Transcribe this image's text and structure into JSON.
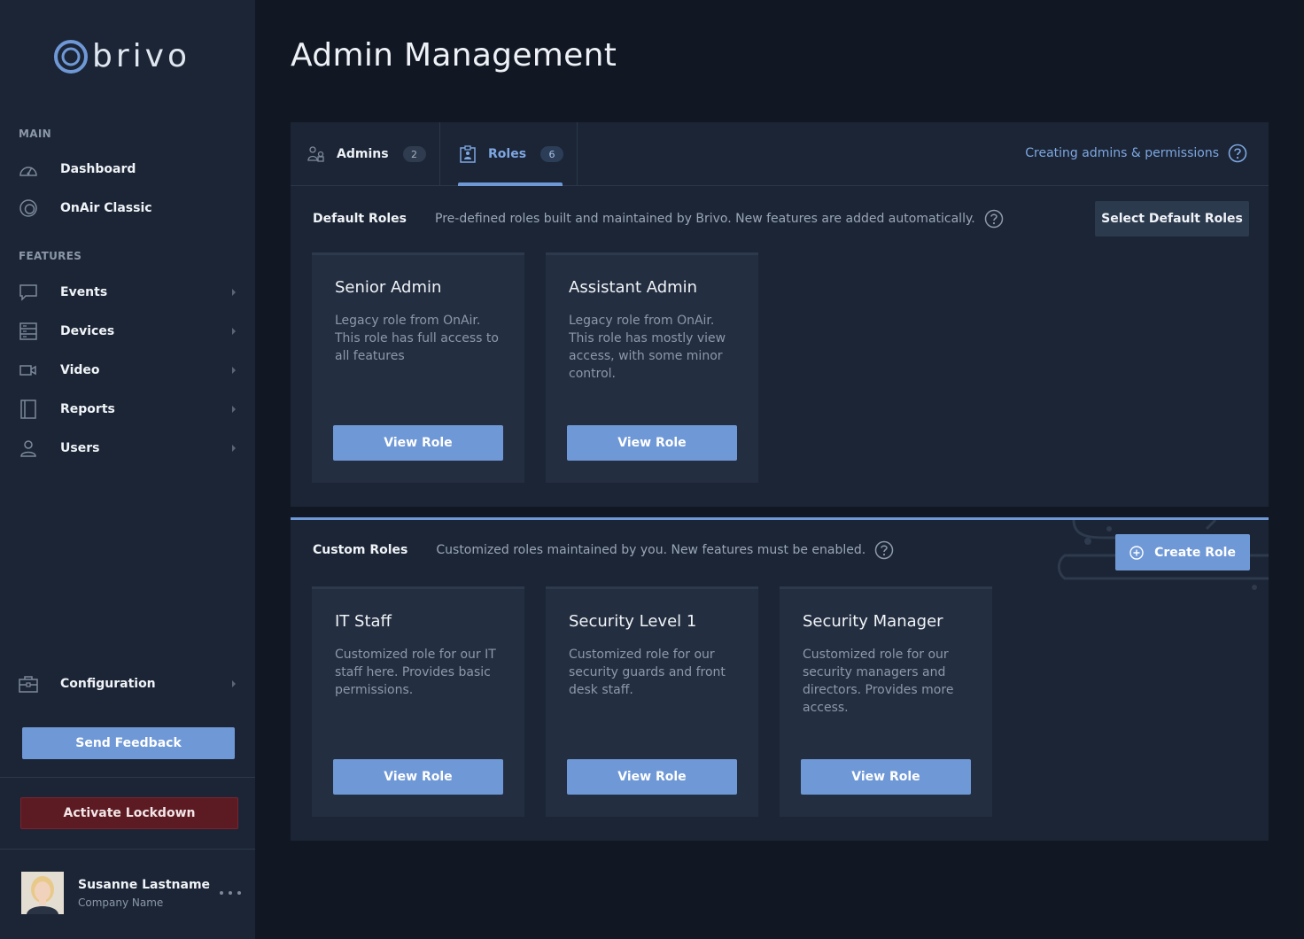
{
  "brand": {
    "name": "brivo"
  },
  "sidebar": {
    "main_label": "MAIN",
    "features_label": "FEATURES",
    "main_items": [
      {
        "label": "Dashboard",
        "icon": "dashboard-icon"
      },
      {
        "label": "OnAir Classic",
        "icon": "onair-icon"
      }
    ],
    "feature_items": [
      {
        "label": "Events",
        "icon": "events-icon"
      },
      {
        "label": "Devices",
        "icon": "devices-icon"
      },
      {
        "label": "Video",
        "icon": "video-icon"
      },
      {
        "label": "Reports",
        "icon": "reports-icon"
      },
      {
        "label": "Users",
        "icon": "users-icon"
      }
    ],
    "configuration": {
      "label": "Configuration",
      "icon": "configuration-icon"
    },
    "send_feedback": "Send Feedback",
    "activate_lockdown": "Activate Lockdown",
    "user": {
      "name": "Susanne Lastname",
      "company": "Company Name"
    }
  },
  "page": {
    "title": "Admin Management"
  },
  "tabs": [
    {
      "label": "Admins",
      "count": "2",
      "icon": "admins-icon",
      "active": false
    },
    {
      "label": "Roles",
      "count": "6",
      "icon": "roles-icon",
      "active": true
    }
  ],
  "help_link": "Creating admins & permissions",
  "default_roles": {
    "title": "Default Roles",
    "description": "Pre-defined roles built and maintained by Brivo. New features are added automatically.",
    "action": "Select Default Roles",
    "cards": [
      {
        "title": "Senior Admin",
        "description": "Legacy role from OnAir. This role has full access to all features",
        "button": "View Role"
      },
      {
        "title": "Assistant Admin",
        "description": "Legacy role from OnAir. This role has mostly view access, with some minor control.",
        "button": "View Role"
      }
    ]
  },
  "custom_roles": {
    "title": "Custom Roles",
    "description": "Customized roles maintained by you. New features must be enabled.",
    "action": "Create Role",
    "cards": [
      {
        "title": "IT Staff",
        "description": "Customized role for our IT staff here. Provides basic permissions.",
        "button": "View Role"
      },
      {
        "title": "Security Level 1",
        "description": "Customized role for our security guards and front desk staff.",
        "button": "View Role"
      },
      {
        "title": "Security Manager",
        "description": "Customized role for our security managers and directors. Provides more access.",
        "button": "View Role"
      }
    ]
  },
  "colors": {
    "accent": "#6f98d6",
    "sidebar_bg": "#1b2535",
    "page_bg": "#111823",
    "lockdown": "#5c1b22"
  }
}
